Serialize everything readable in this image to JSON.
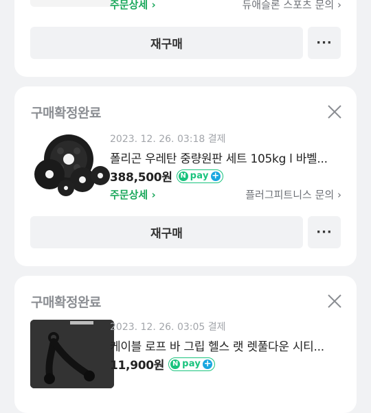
{
  "orders": [
    {
      "order_detail_label": "주문상세",
      "inquiry_label": "듀애슬론 스포츠 문의",
      "rebuy_label": "재구매",
      "more_label": "···"
    },
    {
      "status": "구매확정완료",
      "date": "2023. 12. 26. 03:18 결제",
      "title": "폴리곤 우레탄 중량원판 세트 105kg l 바벨...",
      "price": "388,500원",
      "npay": {
        "n": "N",
        "pay": "pay",
        "plus": "+"
      },
      "order_detail_label": "주문상세",
      "inquiry_label": "플러그피트니스 문의",
      "rebuy_label": "재구매",
      "more_label": "···"
    },
    {
      "status": "구매확정완료",
      "date": "2023. 12. 26. 03:05 결제",
      "title": "케이블 로프 바 그립 헬스 랫 렛풀다운 시티...",
      "price": "11,900원",
      "npay": {
        "n": "N",
        "pay": "pay",
        "plus": "+"
      }
    }
  ],
  "colors": {
    "accent_green": "#19a75a",
    "npay_green": "#19c37d",
    "npay_blue": "#19a7e0"
  }
}
